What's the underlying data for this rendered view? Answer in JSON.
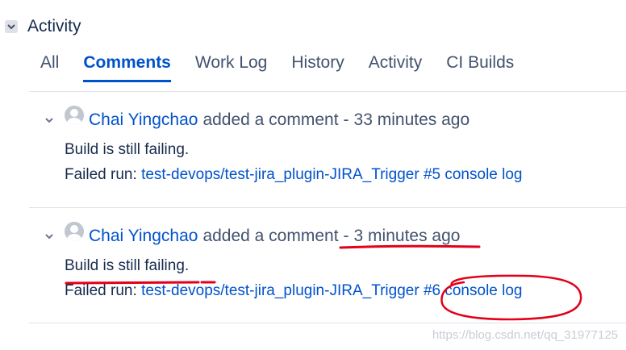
{
  "section": {
    "title": "Activity"
  },
  "tabs": [
    {
      "label": "All",
      "active": false
    },
    {
      "label": "Comments",
      "active": true
    },
    {
      "label": "Work Log",
      "active": false
    },
    {
      "label": "History",
      "active": false
    },
    {
      "label": "Activity",
      "active": false
    },
    {
      "label": "CI Builds",
      "active": false
    }
  ],
  "comments": [
    {
      "author": "Chai Yingchao",
      "action": "added a comment",
      "separator": "-",
      "time": "33 minutes ago",
      "text": "Build is still failing.",
      "failed_label": "Failed run:",
      "job_link": "test-devops/test-jira_plugin-JIRA_Trigger",
      "build_link": "#5 console log"
    },
    {
      "author": "Chai Yingchao",
      "action": "added a comment",
      "separator": "-",
      "time": "3 minutes ago",
      "text": "Build is still failing.",
      "failed_label": "Failed run:",
      "job_link": "test-devops/test-jira_plugin-JIRA_Trigger",
      "build_link": "#6 console log"
    }
  ],
  "watermark": "https://blog.csdn.net/qq_31977125",
  "colors": {
    "link": "#0052cc",
    "text": "#172b4d",
    "annotation": "#e2001a"
  },
  "icons": [
    "chevron-down-icon",
    "avatar-placeholder-icon"
  ]
}
